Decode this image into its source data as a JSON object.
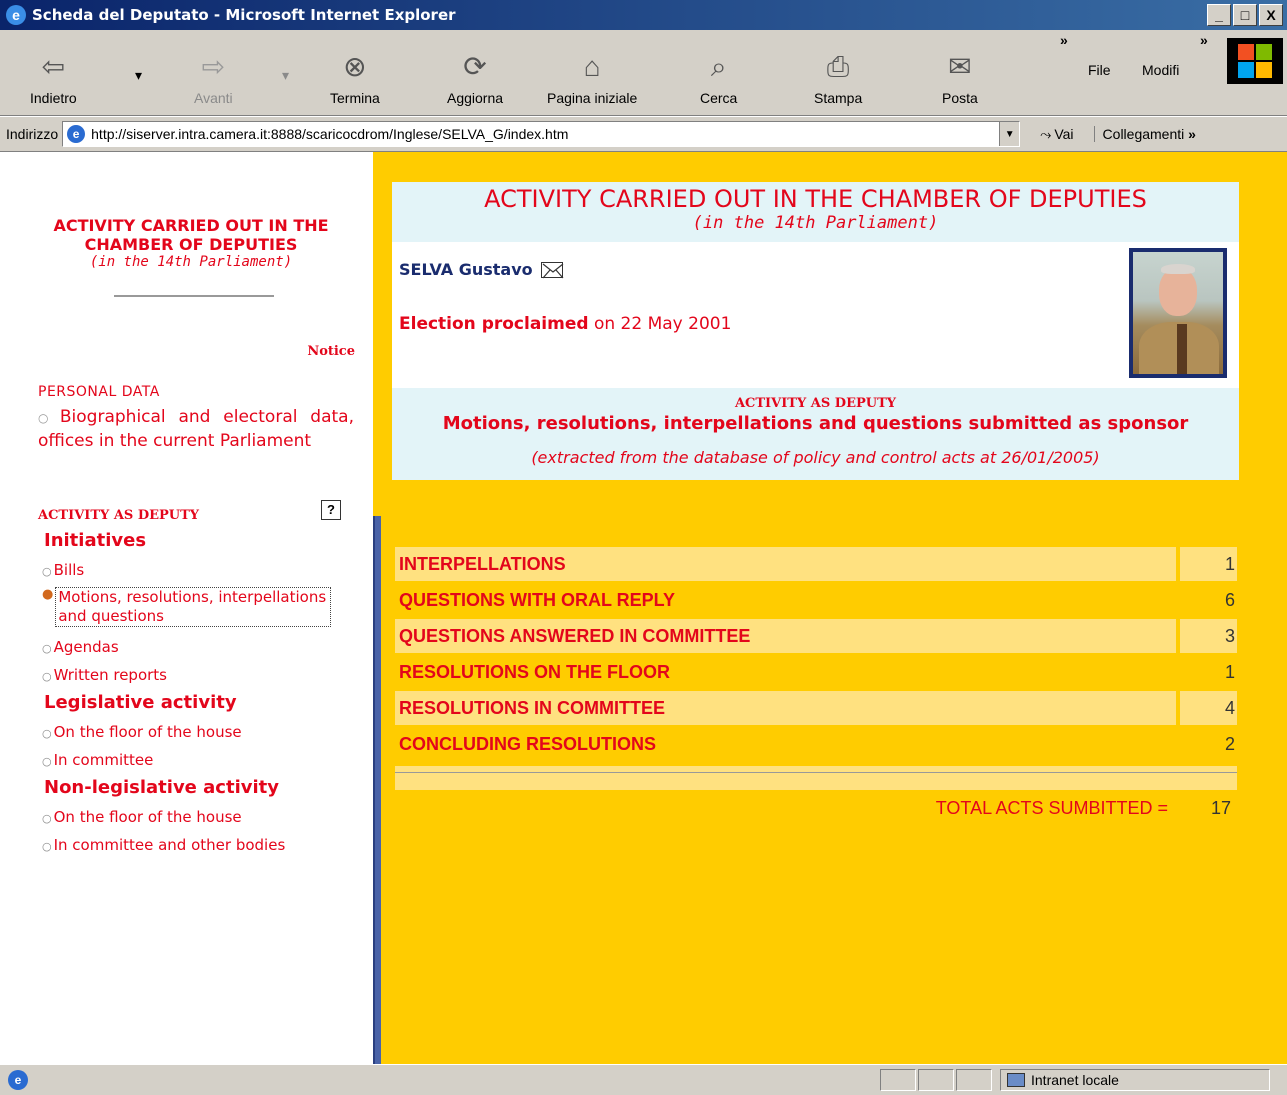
{
  "window": {
    "title": "Scheda del Deputato - Microsoft Internet Explorer",
    "min_label": "_",
    "max_label": "□",
    "close_label": "X"
  },
  "toolbar": {
    "back": "Indietro",
    "forward": "Avanti",
    "stop": "Termina",
    "refresh": "Aggiorna",
    "home": "Pagina iniziale",
    "search": "Cerca",
    "print": "Stampa",
    "mail": "Posta",
    "more": "»",
    "menu_file": "File",
    "menu_edit": "Modifi",
    "menu_more": "»"
  },
  "address": {
    "label": "Indirizzo",
    "url": "http://siserver.intra.camera.it:8888/scaricocdrom/Inglese/SELVA_G/index.htm",
    "go": "Vai",
    "links": "Collegamenti",
    "links_more": "»"
  },
  "left": {
    "title": "ACTIVITY CARRIED OUT IN THE CHAMBER OF DEPUTIES",
    "subtitle": "(in the 14th Parliament)",
    "notice": "Notice",
    "personal_data": "PERSONAL DATA",
    "bio": "Biographical and electoral data, offices in the current Parliament",
    "activity_heading": "ACTIVITY AS DEPUTY",
    "help": "?",
    "initiatives": "Initiatives",
    "bills": "Bills",
    "motions": "Motions, resolutions, interpellations and questions",
    "agendas": "Agendas",
    "written_reports": "Written reports",
    "legislative": "Legislative activity",
    "leg_floor": "On the floor of the house",
    "leg_committee": "In committee",
    "nonlegislative": "Non-legislative activity",
    "nonleg_floor": "On the floor of the house",
    "nonleg_committee": "In committee and other bodies"
  },
  "main": {
    "title": "ACTIVITY CARRIED OUT IN THE CHAMBER OF DEPUTIES",
    "subtitle": "(in the 14th Parliament)",
    "deputy_name": "SELVA Gustavo",
    "election_label": "Election proclaimed",
    "election_date": "on 22 May 2001",
    "activity_heading": "ACTIVITY AS DEPUTY",
    "activity_desc": "Motions, resolutions, interpellations and questions submitted as sponsor",
    "extract_note": "(extracted from the database of policy and control acts at 26/01/2005)",
    "acts": [
      {
        "label": "INTERPELLATIONS",
        "count": "1"
      },
      {
        "label": "QUESTIONS WITH ORAL REPLY",
        "count": "6"
      },
      {
        "label": "QUESTIONS ANSWERED IN COMMITTEE",
        "count": "3"
      },
      {
        "label": "RESOLUTIONS ON THE FLOOR",
        "count": "1"
      },
      {
        "label": "RESOLUTIONS IN COMMITTEE",
        "count": "4"
      },
      {
        "label": "CONCLUDING RESOLUTIONS",
        "count": "2"
      }
    ],
    "total_label": "TOTAL ACTS SUMBITTED =",
    "total_value": "17"
  },
  "status": {
    "zone": "Intranet locale"
  },
  "colors": {
    "accent_red": "#e3061b",
    "page_yellow": "#ffcc00",
    "row_shade": "#ffe180",
    "name_blue": "#1a2c6e"
  }
}
